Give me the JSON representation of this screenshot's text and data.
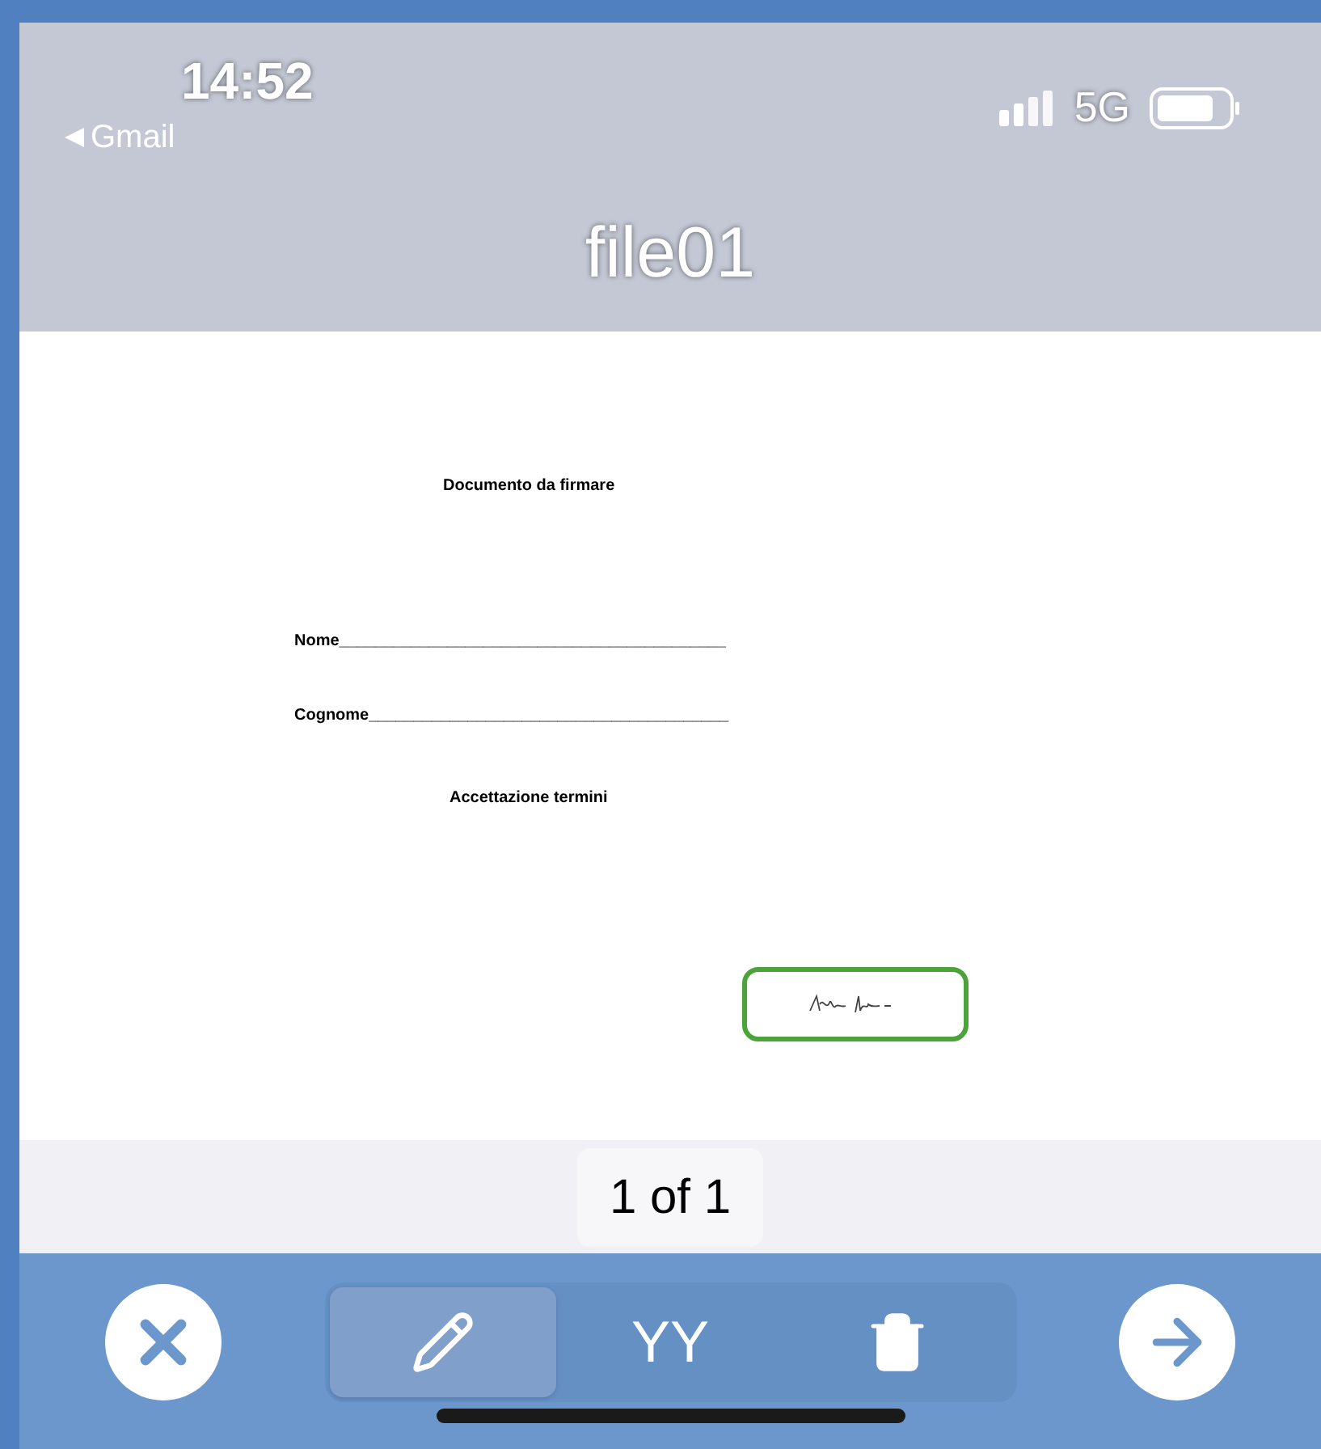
{
  "status_bar": {
    "time": "14:52",
    "back_label": "Gmail",
    "network": "5G"
  },
  "title": "file01",
  "document": {
    "heading": "Documento da firmare",
    "fields": [
      "Nome___________________________________________",
      "Cognome________________________________________"
    ],
    "section": "Accettazione termini",
    "signature": {
      "signed": true
    }
  },
  "page_indicator": "1 of 1",
  "toolbar": {
    "segments": [
      {
        "kind": "pen",
        "selected": true
      },
      {
        "kind": "text",
        "label": "YY",
        "selected": false
      },
      {
        "kind": "delete",
        "selected": false
      }
    ]
  }
}
